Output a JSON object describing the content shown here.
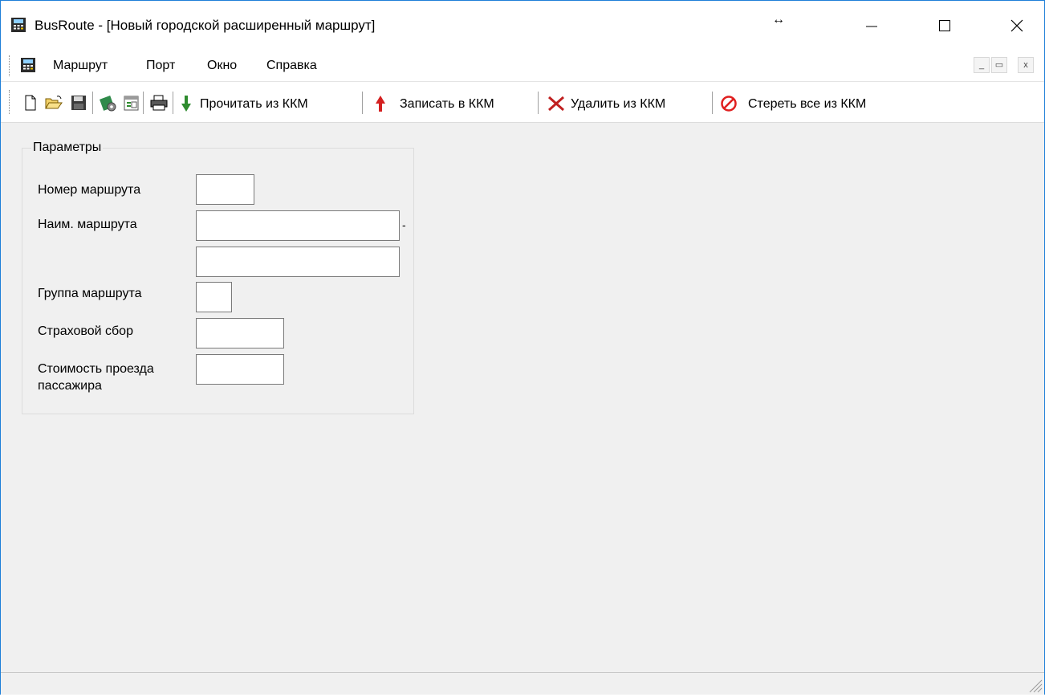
{
  "window": {
    "title": "BusRoute - [Новый городской расширенный маршрут]",
    "resize_indicator": "↔",
    "controls": [
      "minimize",
      "maximize",
      "close"
    ]
  },
  "menubar": {
    "items": [
      {
        "label": "Маршрут"
      },
      {
        "label": "Порт"
      },
      {
        "label": "Окно"
      },
      {
        "label": "Справка"
      }
    ],
    "mdi_controls": {
      "minimize": "_",
      "restore": "▭",
      "close": "x"
    }
  },
  "toolbar": {
    "icons": [
      "new-file-icon",
      "open-folder-icon",
      "save-icon",
      "settings-icon",
      "properties-icon",
      "print-icon"
    ],
    "read_label": "Прочитать из ККМ",
    "write_label": "Записать в ККМ",
    "delete_label": "Удалить из ККМ",
    "erase_label": "Стереть все из ККМ"
  },
  "params": {
    "title": "Параметры",
    "route_number_label": "Номер маршрута",
    "route_number_value": "",
    "route_name_label": "Наим. маршрута",
    "route_name_value_1": "",
    "route_name_separator": "-",
    "route_name_value_2": "",
    "route_group_label": "Группа маршрута",
    "route_group_value": "",
    "insurance_fee_label": "Страховой сбор",
    "insurance_fee_value": "",
    "passenger_fare_label_line1": "Стоимость проезда",
    "passenger_fare_label_line2": "пассажира",
    "passenger_fare_value": ""
  },
  "colors": {
    "accent_border": "#1e7fd8",
    "background": "#f0f0f0",
    "read_arrow": "#2e8b2e",
    "write_arrow": "#d42020",
    "delete_x": "#c02020",
    "erase_icon": "#e02020"
  }
}
